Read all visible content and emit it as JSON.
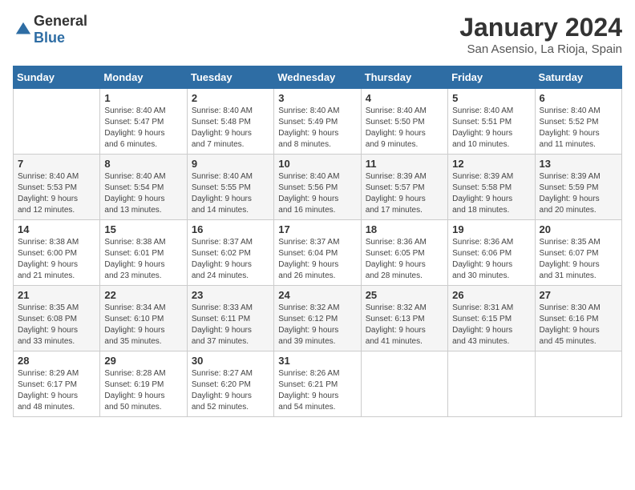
{
  "header": {
    "logo_general": "General",
    "logo_blue": "Blue",
    "month_title": "January 2024",
    "location": "San Asensio, La Rioja, Spain"
  },
  "weekdays": [
    "Sunday",
    "Monday",
    "Tuesday",
    "Wednesday",
    "Thursday",
    "Friday",
    "Saturday"
  ],
  "weeks": [
    [
      {
        "day": "",
        "info": ""
      },
      {
        "day": "1",
        "info": "Sunrise: 8:40 AM\nSunset: 5:47 PM\nDaylight: 9 hours\nand 6 minutes."
      },
      {
        "day": "2",
        "info": "Sunrise: 8:40 AM\nSunset: 5:48 PM\nDaylight: 9 hours\nand 7 minutes."
      },
      {
        "day": "3",
        "info": "Sunrise: 8:40 AM\nSunset: 5:49 PM\nDaylight: 9 hours\nand 8 minutes."
      },
      {
        "day": "4",
        "info": "Sunrise: 8:40 AM\nSunset: 5:50 PM\nDaylight: 9 hours\nand 9 minutes."
      },
      {
        "day": "5",
        "info": "Sunrise: 8:40 AM\nSunset: 5:51 PM\nDaylight: 9 hours\nand 10 minutes."
      },
      {
        "day": "6",
        "info": "Sunrise: 8:40 AM\nSunset: 5:52 PM\nDaylight: 9 hours\nand 11 minutes."
      }
    ],
    [
      {
        "day": "7",
        "info": "Sunrise: 8:40 AM\nSunset: 5:53 PM\nDaylight: 9 hours\nand 12 minutes."
      },
      {
        "day": "8",
        "info": "Sunrise: 8:40 AM\nSunset: 5:54 PM\nDaylight: 9 hours\nand 13 minutes."
      },
      {
        "day": "9",
        "info": "Sunrise: 8:40 AM\nSunset: 5:55 PM\nDaylight: 9 hours\nand 14 minutes."
      },
      {
        "day": "10",
        "info": "Sunrise: 8:40 AM\nSunset: 5:56 PM\nDaylight: 9 hours\nand 16 minutes."
      },
      {
        "day": "11",
        "info": "Sunrise: 8:39 AM\nSunset: 5:57 PM\nDaylight: 9 hours\nand 17 minutes."
      },
      {
        "day": "12",
        "info": "Sunrise: 8:39 AM\nSunset: 5:58 PM\nDaylight: 9 hours\nand 18 minutes."
      },
      {
        "day": "13",
        "info": "Sunrise: 8:39 AM\nSunset: 5:59 PM\nDaylight: 9 hours\nand 20 minutes."
      }
    ],
    [
      {
        "day": "14",
        "info": "Sunrise: 8:38 AM\nSunset: 6:00 PM\nDaylight: 9 hours\nand 21 minutes."
      },
      {
        "day": "15",
        "info": "Sunrise: 8:38 AM\nSunset: 6:01 PM\nDaylight: 9 hours\nand 23 minutes."
      },
      {
        "day": "16",
        "info": "Sunrise: 8:37 AM\nSunset: 6:02 PM\nDaylight: 9 hours\nand 24 minutes."
      },
      {
        "day": "17",
        "info": "Sunrise: 8:37 AM\nSunset: 6:04 PM\nDaylight: 9 hours\nand 26 minutes."
      },
      {
        "day": "18",
        "info": "Sunrise: 8:36 AM\nSunset: 6:05 PM\nDaylight: 9 hours\nand 28 minutes."
      },
      {
        "day": "19",
        "info": "Sunrise: 8:36 AM\nSunset: 6:06 PM\nDaylight: 9 hours\nand 30 minutes."
      },
      {
        "day": "20",
        "info": "Sunrise: 8:35 AM\nSunset: 6:07 PM\nDaylight: 9 hours\nand 31 minutes."
      }
    ],
    [
      {
        "day": "21",
        "info": "Sunrise: 8:35 AM\nSunset: 6:08 PM\nDaylight: 9 hours\nand 33 minutes."
      },
      {
        "day": "22",
        "info": "Sunrise: 8:34 AM\nSunset: 6:10 PM\nDaylight: 9 hours\nand 35 minutes."
      },
      {
        "day": "23",
        "info": "Sunrise: 8:33 AM\nSunset: 6:11 PM\nDaylight: 9 hours\nand 37 minutes."
      },
      {
        "day": "24",
        "info": "Sunrise: 8:32 AM\nSunset: 6:12 PM\nDaylight: 9 hours\nand 39 minutes."
      },
      {
        "day": "25",
        "info": "Sunrise: 8:32 AM\nSunset: 6:13 PM\nDaylight: 9 hours\nand 41 minutes."
      },
      {
        "day": "26",
        "info": "Sunrise: 8:31 AM\nSunset: 6:15 PM\nDaylight: 9 hours\nand 43 minutes."
      },
      {
        "day": "27",
        "info": "Sunrise: 8:30 AM\nSunset: 6:16 PM\nDaylight: 9 hours\nand 45 minutes."
      }
    ],
    [
      {
        "day": "28",
        "info": "Sunrise: 8:29 AM\nSunset: 6:17 PM\nDaylight: 9 hours\nand 48 minutes."
      },
      {
        "day": "29",
        "info": "Sunrise: 8:28 AM\nSunset: 6:19 PM\nDaylight: 9 hours\nand 50 minutes."
      },
      {
        "day": "30",
        "info": "Sunrise: 8:27 AM\nSunset: 6:20 PM\nDaylight: 9 hours\nand 52 minutes."
      },
      {
        "day": "31",
        "info": "Sunrise: 8:26 AM\nSunset: 6:21 PM\nDaylight: 9 hours\nand 54 minutes."
      },
      {
        "day": "",
        "info": ""
      },
      {
        "day": "",
        "info": ""
      },
      {
        "day": "",
        "info": ""
      }
    ]
  ]
}
